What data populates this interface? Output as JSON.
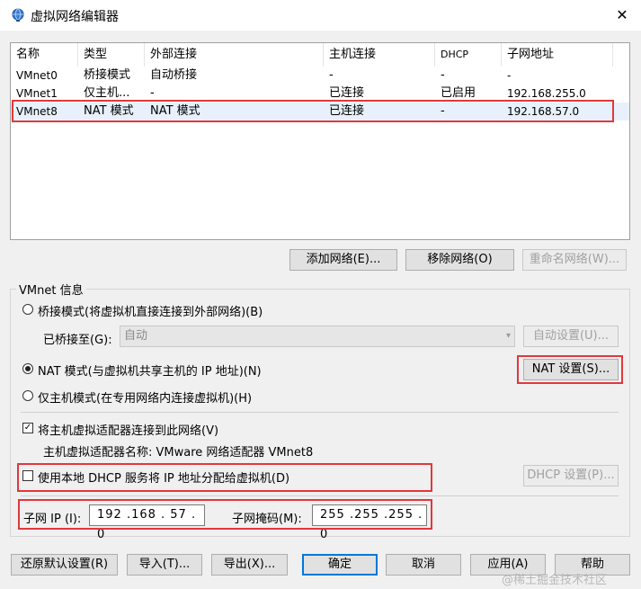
{
  "window": {
    "title": "虚拟网络编辑器",
    "close_label": "✕"
  },
  "table": {
    "columns": [
      "名称",
      "类型",
      "外部连接",
      "主机连接",
      "DHCP",
      "子网地址"
    ],
    "rows": [
      [
        "VMnet0",
        "桥接模式",
        "自动桥接",
        "-",
        "-",
        "-"
      ],
      [
        "VMnet1",
        "仅主机...",
        "-",
        "已连接",
        "已启用",
        "192.168.255.0"
      ],
      [
        "VMnet8",
        "NAT 模式",
        "NAT 模式",
        "已连接",
        "-",
        "192.168.57.0"
      ]
    ],
    "highlighted_row": 2
  },
  "table_buttons": {
    "add": "添加网络(E)...",
    "remove": "移除网络(O)",
    "rename": "重命名网络(W)..."
  },
  "vmnet_info": {
    "title": "VMnet 信息",
    "bridge_radio": "桥接模式(将虚拟机直接连接到外部网络)(B)",
    "bridged_to_label": "已桥接至(G):",
    "bridged_to_value": "自动",
    "auto_settings": "自动设置(U)...",
    "nat_radio": "NAT 模式(与虚拟机共享主机的 IP 地址)(N)",
    "nat_settings": "NAT 设置(S)...",
    "host_only_radio": "仅主机模式(在专用网络内连接虚拟机)(H)",
    "selected_mode": "nat",
    "connect_adapter_check": "将主机虚拟适配器连接到此网络(V)",
    "connect_adapter_checked": true,
    "adapter_name_label": "主机虚拟适配器名称: VMware 网络适配器 VMnet8",
    "dhcp_check": "使用本地 DHCP 服务将 IP 地址分配给虚拟机(D)",
    "dhcp_checked": false,
    "dhcp_settings": "DHCP 设置(P)...",
    "subnet_ip_label": "子网 IP (I):",
    "subnet_ip_value": "192 .168 . 57 . 0",
    "subnet_mask_label": "子网掩码(M):",
    "subnet_mask_value": "255 .255 .255 . 0"
  },
  "footer": {
    "restore": "还原默认设置(R)",
    "import": "导入(T)...",
    "export": "导出(X)...",
    "ok": "确定",
    "cancel": "取消",
    "apply": "应用(A)",
    "help": "帮助"
  },
  "watermark": "@稀土掘金技术社区",
  "colors": {
    "highlight": "#e0383e",
    "focus": "#0078d7"
  }
}
